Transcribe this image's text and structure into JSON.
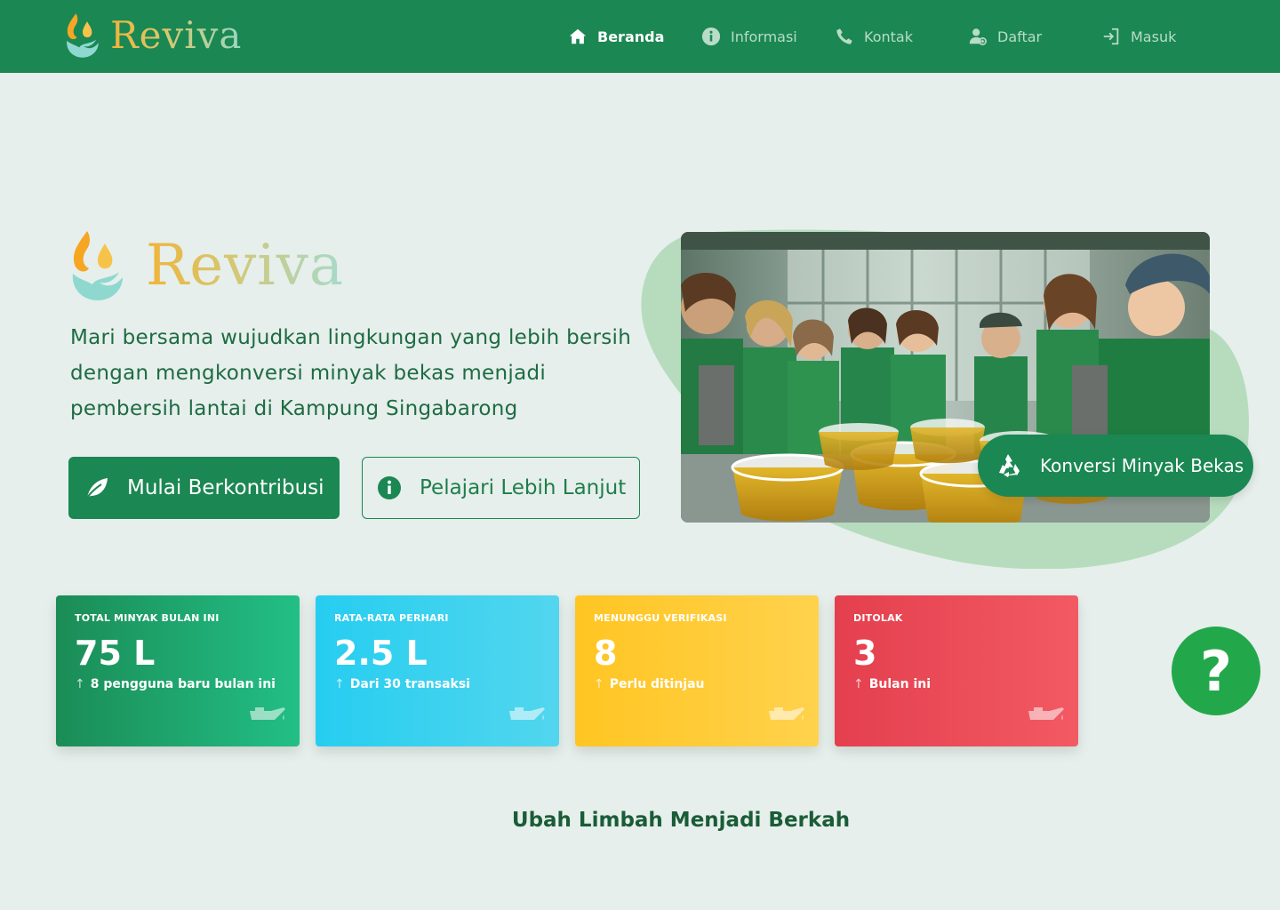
{
  "brand": {
    "name": "Reviva"
  },
  "nav": {
    "items": [
      {
        "label": "Beranda",
        "icon": "home-icon",
        "active": true
      },
      {
        "label": "Informasi",
        "icon": "info-icon",
        "active": false
      },
      {
        "label": "Kontak",
        "icon": "phone-icon",
        "active": false
      },
      {
        "label": "Daftar",
        "icon": "user-plus-icon",
        "active": false
      },
      {
        "label": "Masuk",
        "icon": "login-icon",
        "active": false
      }
    ]
  },
  "hero": {
    "brand": "Reviva",
    "description": "Mari bersama wujudkan lingkungan yang lebih bersih dengan mengkonversi minyak bekas menjadi pembersih lantai di Kampung Singabarong",
    "primary_button": "Mulai Berkontribusi",
    "secondary_button": "Pelajari Lebih Lanjut",
    "badge": "Konversi Minyak Bekas"
  },
  "stats": [
    {
      "label": "TOTAL MINYAK BULAN INI",
      "value": "75 L",
      "sub": "8 pengguna baru bulan ini",
      "color_start": "#1b8c56",
      "color_end": "#22bf86"
    },
    {
      "label": "RATA-RATA PERHARI",
      "value": "2.5 L",
      "sub": "Dari 30 transaksi",
      "color_start": "#26cdf0",
      "color_end": "#52d6ee"
    },
    {
      "label": "MENUNGGU VERIFIKASI",
      "value": "8",
      "sub": "Perlu ditinjau",
      "color_start": "#ffc522",
      "color_end": "#ffd24d"
    },
    {
      "label": "DITOLAK",
      "value": "3",
      "sub": "Bulan ini",
      "color_start": "#e43f4e",
      "color_end": "#f25a63"
    }
  ],
  "help": {
    "label": "?"
  },
  "section": {
    "title": "Ubah Limbah Menjadi Berkah"
  },
  "colors": {
    "primary": "#1b8753",
    "background": "#e6efeb",
    "help_button": "#22a84a"
  }
}
